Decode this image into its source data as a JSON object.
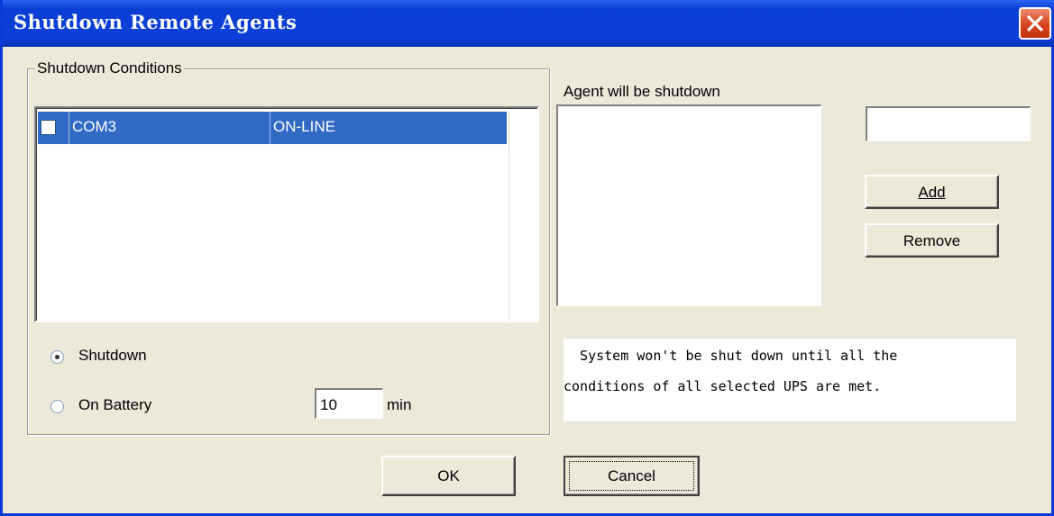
{
  "window": {
    "title": "Shutdown Remote Agents",
    "icons": {
      "close": "close-icon"
    }
  },
  "conditions": {
    "group_label": "Shutdown Conditions",
    "ups_list": [
      {
        "checked": false,
        "port": "COM3",
        "status": "ON-LINE",
        "selected": true
      }
    ],
    "options": [
      {
        "label": "Shutdown",
        "checked": true
      },
      {
        "label": "On Battery",
        "checked": false
      }
    ],
    "battery_minutes": "10",
    "min_label": "min"
  },
  "agents": {
    "list_label": "Agent will be shutdown",
    "items": [],
    "input_value": "",
    "add_label": "Add",
    "remove_label": "Remove"
  },
  "note": {
    "line1": "  System won't be shut down until all the",
    "line2": "conditions of all selected UPS are met."
  },
  "footer": {
    "ok_label": "OK",
    "cancel_label": "Cancel"
  },
  "colors": {
    "titlebar": "#0a3ed4",
    "selection": "#316ac5",
    "dialog_bg": "#ece9d8",
    "close_button": "#d6431f"
  }
}
